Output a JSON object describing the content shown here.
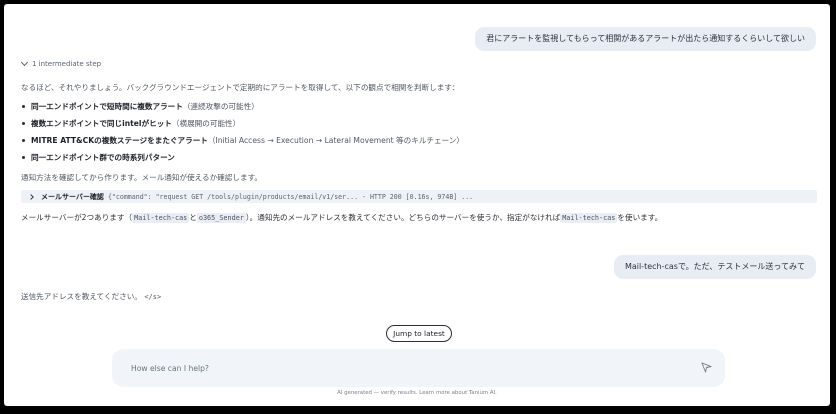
{
  "messages": {
    "user1": "君にアラートを監視してもらって相関があるアラートが出たら通知するくらいして欲しい",
    "user2": "Mail-tech-casで。ただ、テストメール送ってみて"
  },
  "intermediate": {
    "label": "1 intermediate step"
  },
  "assistant": {
    "intro": "なるほど、それやりましょう。バックグラウンドエージェントで定期的にアラートを取得して、以下の観点で相関を判断します：",
    "bullets": [
      {
        "bold": "同一エンドポイントで短時間に複数アラート",
        "note": "（連続攻撃の可能性）"
      },
      {
        "bold": "複数エンドポイントで同じintelがヒット",
        "note": "（横展開の可能性）"
      },
      {
        "bold": "MITRE ATT&CKの複数ステージをまたぐアラート",
        "note": "（Initial Access → Execution → Lateral Movement 等のキルチェーン）"
      },
      {
        "bold": "同一エンドポイント群での時系列パターン",
        "note": ""
      }
    ],
    "after_bullets": "通知方法を確認してから作ります。メール通知が使えるか確認します。",
    "tool": {
      "name": "メールサーバー確認",
      "detail": "{\"command\": \"request GET /tools/plugin/products/email/v1/ser... - HTTP 200 [0.16s, 974B] ..."
    },
    "mail_line": {
      "part1": "メールサーバーが2つあります（",
      "code1": "Mail-tech-cas",
      "part2": "と",
      "code2": "o365_Sender",
      "part3": "）。通知先のメールアドレスを教えてください。どちらのサーバーを使うか、指定がなければ",
      "code3": "Mail-tech-cas",
      "part4": "を使います。"
    },
    "ask_address": "送信先アドレスを教えてください。",
    "ask_tag": "</s>"
  },
  "jump_button": "Jump to latest",
  "composer": {
    "placeholder": "How else can I help?"
  },
  "footer": "AI generated — verify results. Learn more about Tanium AI.",
  "icons": {
    "intermediate": "chevron-down-icon",
    "tool": "chevron-right-icon",
    "send": "send-icon"
  }
}
